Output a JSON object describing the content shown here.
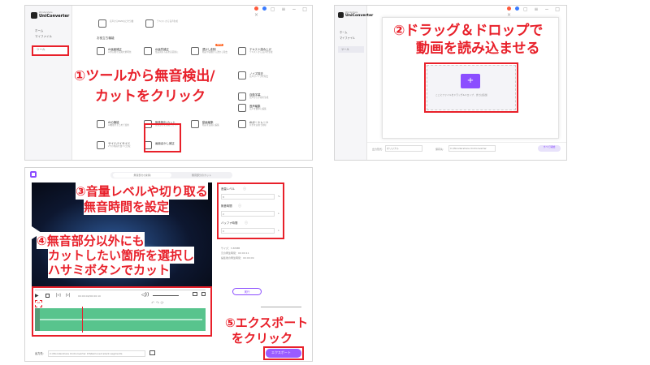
{
  "panel1": {
    "logo_small": "Wondershare",
    "logo_name": "UniConverter",
    "sidebar": [
      "ホーム",
      "マイファイル",
      "ツール"
    ],
    "top_cards": [
      "音声からBGMなどを分離",
      "テキストから音声生成"
    ],
    "section_title": "お役立ち機能",
    "row1": [
      {
        "title": "AI画面補正",
        "desc": "AIが自動で画質を鮮明化"
      },
      {
        "title": "AI画質補正",
        "desc": "低画質な写真を高画質に"
      },
      {
        "title": "透かし削除",
        "desc": "動画や画像から透かし除去",
        "badge": "NEW"
      },
      {
        "title": "テキスト読み上げ",
        "desc": "テキストから音声を生成"
      }
    ],
    "right_cards": [
      {
        "title": "ノイズ除去",
        "desc": "音声のノイズを除去"
      },
      {
        "title": "自動字幕",
        "desc": "音声から字幕を生成"
      },
      {
        "title": "音声編集",
        "desc": "音声を簡単に編集"
      }
    ],
    "row3": [
      {
        "title": "AIの機能",
        "desc": "AI機能をまとめて使用"
      },
      {
        "title": "無音検出/カット",
        "desc": "無音部分を自動でカット"
      },
      {
        "title": "動画編集",
        "desc": "動画を自由に編集"
      },
      {
        "title": "AIポートレート",
        "desc": "背景を自動で削除"
      }
    ],
    "row4": [
      {
        "title": "サイドバイサイド",
        "desc": "2つの動画を並べて比較"
      },
      {
        "title": "画面ぼかし補正",
        "desc": ""
      }
    ],
    "callout_line1": "①ツールから無音検出/",
    "callout_line2": "カットをクリック"
  },
  "panel2": {
    "logo_small": "Wondershare",
    "logo_name": "UniConverter",
    "sidebar": [
      "ホーム",
      "マイファイル",
      "ツール"
    ],
    "callout_line1": "②ドラッグ＆ドロップで",
    "callout_line2": "動画を読み込ませる",
    "drop_text": "ここにファイルをドラッグ&ドロップ、または追加",
    "footer_label": "出力形式:",
    "footer_value": "オリジナル",
    "footer_path_label": "保存先:",
    "footer_path": "C:\\Wondershare UniConverter",
    "footer_button": "すべて開始"
  },
  "panel3": {
    "tabs": [
      "無音部分の削除",
      "無音部分のカット"
    ],
    "callout3_line1": "③音量レベルや切り取る",
    "callout3_line2": "無音時間を設定",
    "callout4_line1": "④無音部分以外にも",
    "callout4_line2": "カットしたい箇所を選択し",
    "callout4_line3": "ハサミボタンでカット",
    "settings": [
      {
        "label": "音量レベル",
        "value": "8",
        "unit": "%"
      },
      {
        "label": "無音時間",
        "value": "2",
        "unit": "s"
      },
      {
        "label": "バッファ時間",
        "value": "0",
        "unit": "s"
      }
    ],
    "info_size": "サイズ：3.83MB",
    "info_original": "元の再生時間：00:00:11",
    "info_after": "編集後の再生時間：00:00:09",
    "timecode": "00:00:02/00:00:10",
    "apply_button": "実行",
    "callout5_line1": "⑤エクスポート",
    "callout5_line2": "をクリック",
    "footer_label": "出力先:",
    "footer_path": "C:\\Wondershare UniConverter 15\\Removed silent segments",
    "export_button": "エクスポート"
  },
  "colors": {
    "accent": "#8b4dff",
    "red": "#e8202a",
    "wave": "#3cb97a"
  }
}
